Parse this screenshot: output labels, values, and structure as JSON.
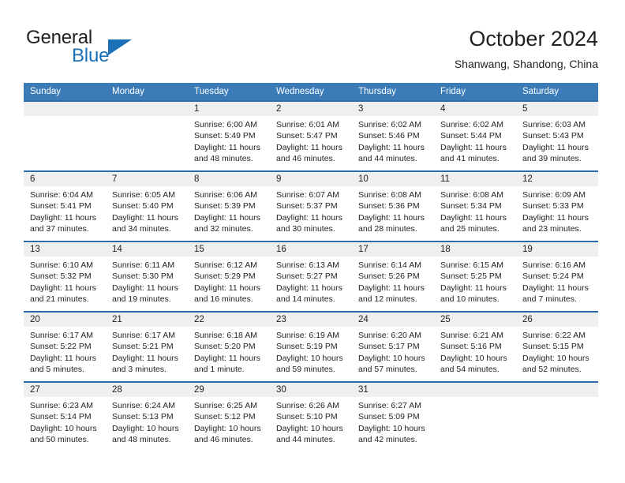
{
  "brand": {
    "name_line1": "General",
    "name_line2": "Blue",
    "accent_color": "#1b71b8"
  },
  "header": {
    "month_title": "October 2024",
    "location": "Shanwang, Shandong, China"
  },
  "calendar": {
    "header_bg": "#3b7cb8",
    "row_border_color": "#2c6ca8",
    "date_band_bg": "#efefef",
    "weekday_headers": [
      "Sunday",
      "Monday",
      "Tuesday",
      "Wednesday",
      "Thursday",
      "Friday",
      "Saturday"
    ],
    "weeks": [
      [
        {
          "date": "",
          "sunrise": "",
          "sunset": "",
          "daylight": ""
        },
        {
          "date": "",
          "sunrise": "",
          "sunset": "",
          "daylight": ""
        },
        {
          "date": "1",
          "sunrise": "Sunrise: 6:00 AM",
          "sunset": "Sunset: 5:49 PM",
          "daylight": "Daylight: 11 hours and 48 minutes."
        },
        {
          "date": "2",
          "sunrise": "Sunrise: 6:01 AM",
          "sunset": "Sunset: 5:47 PM",
          "daylight": "Daylight: 11 hours and 46 minutes."
        },
        {
          "date": "3",
          "sunrise": "Sunrise: 6:02 AM",
          "sunset": "Sunset: 5:46 PM",
          "daylight": "Daylight: 11 hours and 44 minutes."
        },
        {
          "date": "4",
          "sunrise": "Sunrise: 6:02 AM",
          "sunset": "Sunset: 5:44 PM",
          "daylight": "Daylight: 11 hours and 41 minutes."
        },
        {
          "date": "5",
          "sunrise": "Sunrise: 6:03 AM",
          "sunset": "Sunset: 5:43 PM",
          "daylight": "Daylight: 11 hours and 39 minutes."
        }
      ],
      [
        {
          "date": "6",
          "sunrise": "Sunrise: 6:04 AM",
          "sunset": "Sunset: 5:41 PM",
          "daylight": "Daylight: 11 hours and 37 minutes."
        },
        {
          "date": "7",
          "sunrise": "Sunrise: 6:05 AM",
          "sunset": "Sunset: 5:40 PM",
          "daylight": "Daylight: 11 hours and 34 minutes."
        },
        {
          "date": "8",
          "sunrise": "Sunrise: 6:06 AM",
          "sunset": "Sunset: 5:39 PM",
          "daylight": "Daylight: 11 hours and 32 minutes."
        },
        {
          "date": "9",
          "sunrise": "Sunrise: 6:07 AM",
          "sunset": "Sunset: 5:37 PM",
          "daylight": "Daylight: 11 hours and 30 minutes."
        },
        {
          "date": "10",
          "sunrise": "Sunrise: 6:08 AM",
          "sunset": "Sunset: 5:36 PM",
          "daylight": "Daylight: 11 hours and 28 minutes."
        },
        {
          "date": "11",
          "sunrise": "Sunrise: 6:08 AM",
          "sunset": "Sunset: 5:34 PM",
          "daylight": "Daylight: 11 hours and 25 minutes."
        },
        {
          "date": "12",
          "sunrise": "Sunrise: 6:09 AM",
          "sunset": "Sunset: 5:33 PM",
          "daylight": "Daylight: 11 hours and 23 minutes."
        }
      ],
      [
        {
          "date": "13",
          "sunrise": "Sunrise: 6:10 AM",
          "sunset": "Sunset: 5:32 PM",
          "daylight": "Daylight: 11 hours and 21 minutes."
        },
        {
          "date": "14",
          "sunrise": "Sunrise: 6:11 AM",
          "sunset": "Sunset: 5:30 PM",
          "daylight": "Daylight: 11 hours and 19 minutes."
        },
        {
          "date": "15",
          "sunrise": "Sunrise: 6:12 AM",
          "sunset": "Sunset: 5:29 PM",
          "daylight": "Daylight: 11 hours and 16 minutes."
        },
        {
          "date": "16",
          "sunrise": "Sunrise: 6:13 AM",
          "sunset": "Sunset: 5:27 PM",
          "daylight": "Daylight: 11 hours and 14 minutes."
        },
        {
          "date": "17",
          "sunrise": "Sunrise: 6:14 AM",
          "sunset": "Sunset: 5:26 PM",
          "daylight": "Daylight: 11 hours and 12 minutes."
        },
        {
          "date": "18",
          "sunrise": "Sunrise: 6:15 AM",
          "sunset": "Sunset: 5:25 PM",
          "daylight": "Daylight: 11 hours and 10 minutes."
        },
        {
          "date": "19",
          "sunrise": "Sunrise: 6:16 AM",
          "sunset": "Sunset: 5:24 PM",
          "daylight": "Daylight: 11 hours and 7 minutes."
        }
      ],
      [
        {
          "date": "20",
          "sunrise": "Sunrise: 6:17 AM",
          "sunset": "Sunset: 5:22 PM",
          "daylight": "Daylight: 11 hours and 5 minutes."
        },
        {
          "date": "21",
          "sunrise": "Sunrise: 6:17 AM",
          "sunset": "Sunset: 5:21 PM",
          "daylight": "Daylight: 11 hours and 3 minutes."
        },
        {
          "date": "22",
          "sunrise": "Sunrise: 6:18 AM",
          "sunset": "Sunset: 5:20 PM",
          "daylight": "Daylight: 11 hours and 1 minute."
        },
        {
          "date": "23",
          "sunrise": "Sunrise: 6:19 AM",
          "sunset": "Sunset: 5:19 PM",
          "daylight": "Daylight: 10 hours and 59 minutes."
        },
        {
          "date": "24",
          "sunrise": "Sunrise: 6:20 AM",
          "sunset": "Sunset: 5:17 PM",
          "daylight": "Daylight: 10 hours and 57 minutes."
        },
        {
          "date": "25",
          "sunrise": "Sunrise: 6:21 AM",
          "sunset": "Sunset: 5:16 PM",
          "daylight": "Daylight: 10 hours and 54 minutes."
        },
        {
          "date": "26",
          "sunrise": "Sunrise: 6:22 AM",
          "sunset": "Sunset: 5:15 PM",
          "daylight": "Daylight: 10 hours and 52 minutes."
        }
      ],
      [
        {
          "date": "27",
          "sunrise": "Sunrise: 6:23 AM",
          "sunset": "Sunset: 5:14 PM",
          "daylight": "Daylight: 10 hours and 50 minutes."
        },
        {
          "date": "28",
          "sunrise": "Sunrise: 6:24 AM",
          "sunset": "Sunset: 5:13 PM",
          "daylight": "Daylight: 10 hours and 48 minutes."
        },
        {
          "date": "29",
          "sunrise": "Sunrise: 6:25 AM",
          "sunset": "Sunset: 5:12 PM",
          "daylight": "Daylight: 10 hours and 46 minutes."
        },
        {
          "date": "30",
          "sunrise": "Sunrise: 6:26 AM",
          "sunset": "Sunset: 5:10 PM",
          "daylight": "Daylight: 10 hours and 44 minutes."
        },
        {
          "date": "31",
          "sunrise": "Sunrise: 6:27 AM",
          "sunset": "Sunset: 5:09 PM",
          "daylight": "Daylight: 10 hours and 42 minutes."
        },
        {
          "date": "",
          "sunrise": "",
          "sunset": "",
          "daylight": ""
        },
        {
          "date": "",
          "sunrise": "",
          "sunset": "",
          "daylight": ""
        }
      ]
    ]
  }
}
